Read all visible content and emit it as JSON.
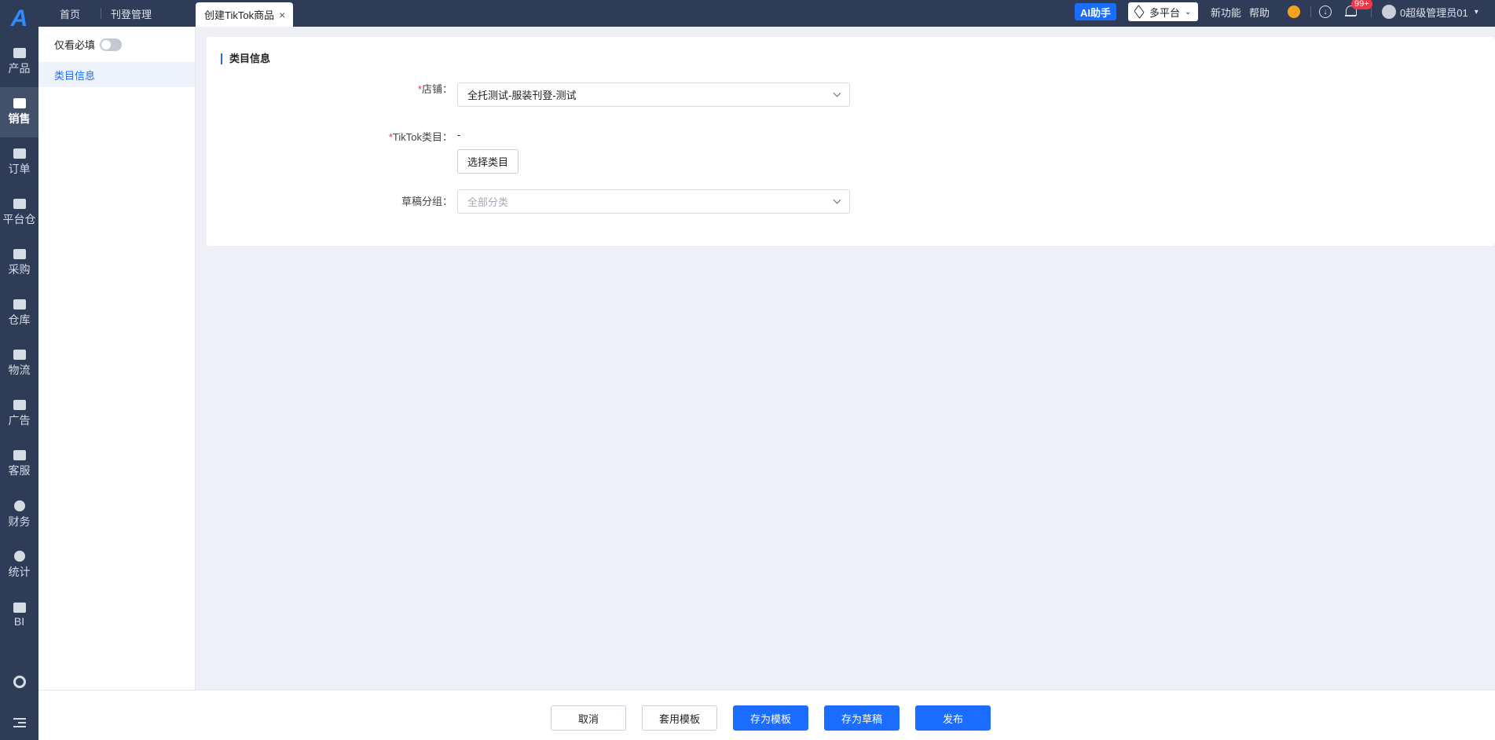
{
  "rail": {
    "logo": "A",
    "items": [
      {
        "label": "产品",
        "icon": "product-icon"
      },
      {
        "label": "销售",
        "icon": "sell-icon",
        "active": true
      },
      {
        "label": "订单",
        "icon": "order-icon"
      },
      {
        "label": "平台仓",
        "icon": "platform-warehouse-icon"
      },
      {
        "label": "采购",
        "icon": "cart-icon"
      },
      {
        "label": "仓库",
        "icon": "warehouse-icon"
      },
      {
        "label": "物流",
        "icon": "truck-icon"
      },
      {
        "label": "广告",
        "icon": "ad-icon"
      },
      {
        "label": "客服",
        "icon": "mail-icon"
      },
      {
        "label": "财务",
        "icon": "yen-icon"
      },
      {
        "label": "统计",
        "icon": "pie-chart-icon"
      },
      {
        "label": "BI",
        "icon": "bi-icon"
      }
    ]
  },
  "topbar": {
    "tabs": {
      "home": "首页",
      "listing": "刊登管理",
      "active": "创建TikTok商品",
      "close": "×"
    },
    "ai_button": "AI助手",
    "platform_selector": "多平台",
    "new_features": "新功能",
    "help": "帮助",
    "notification_badge": "99+",
    "user_name": "0超级管理员01"
  },
  "subnav": {
    "only_required": "仅看必填",
    "items": [
      "类目信息"
    ]
  },
  "form": {
    "section_title": "类目信息",
    "shop": {
      "required_mark": "*",
      "label": "店铺：",
      "value": "全托测试-服装刊登-测试"
    },
    "category": {
      "required_mark": "*",
      "label": "TikTok类目：",
      "value": "-",
      "choose_button": "选择类目"
    },
    "draft_group": {
      "label": "草稿分组：",
      "placeholder": "全部分类"
    }
  },
  "footer": {
    "cancel": "取消",
    "apply_template": "套用模板",
    "save_template": "存为模板",
    "save_draft": "存为草稿",
    "publish": "发布"
  },
  "colors": {
    "nav_bg": "#2e3c57",
    "accent": "#1a6dff",
    "required": "#e8333a",
    "badge": "#f0364a"
  }
}
